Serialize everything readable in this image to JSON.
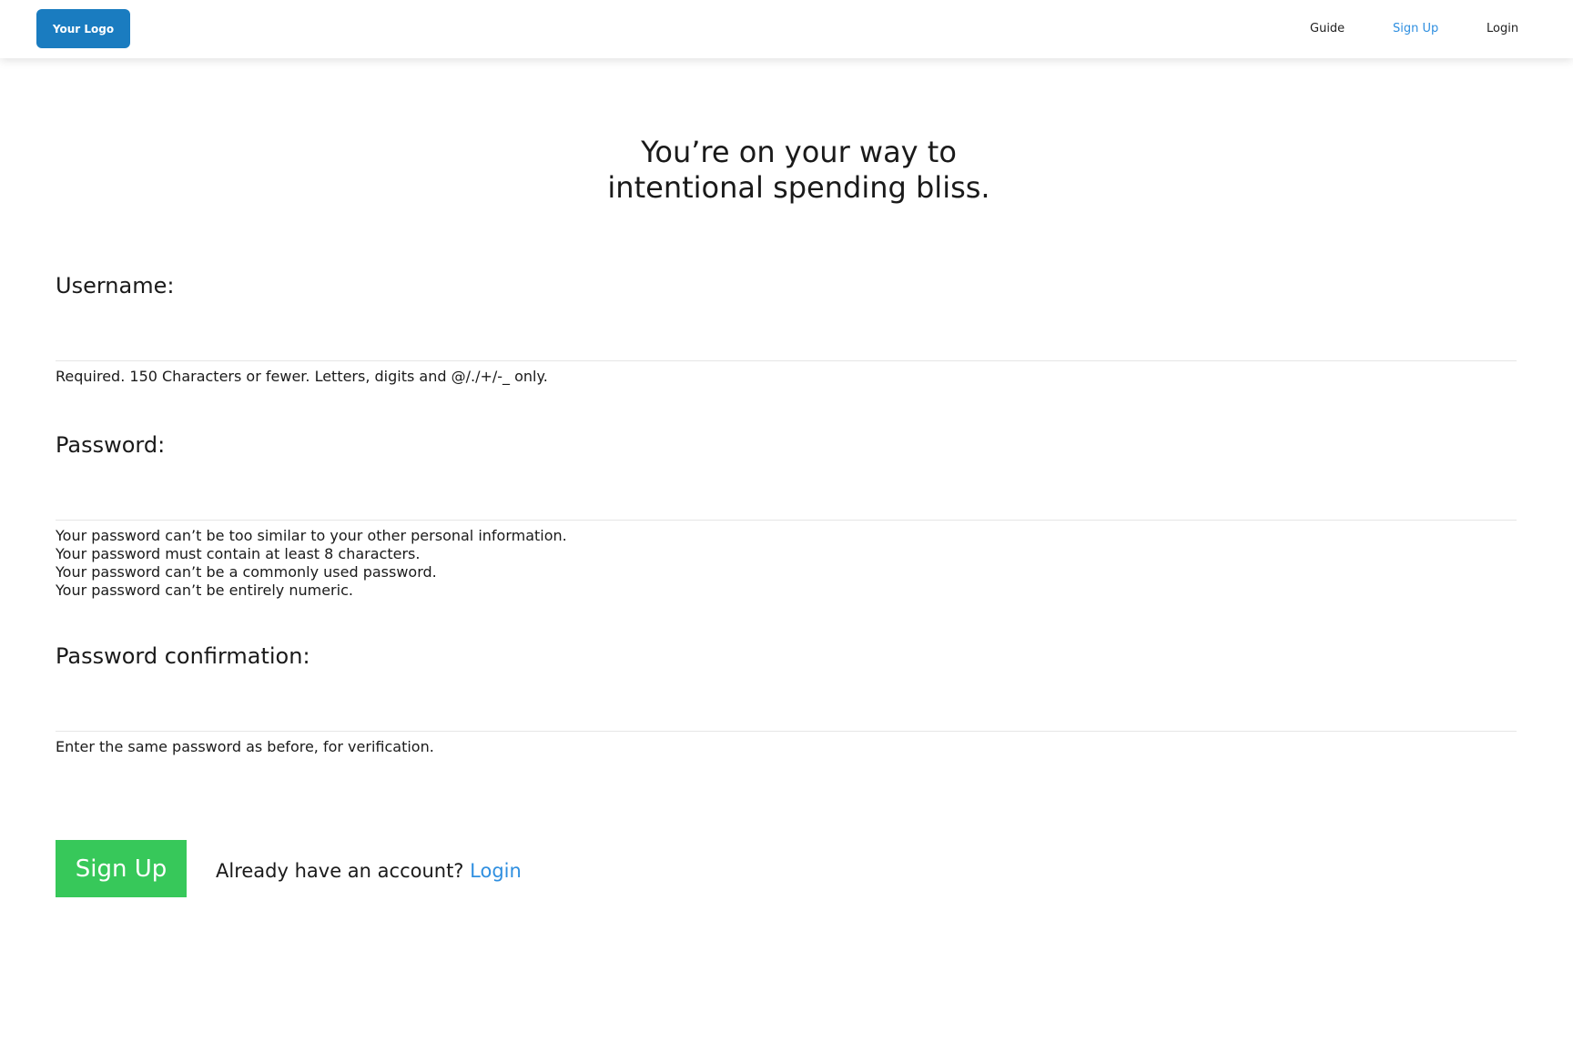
{
  "nav": {
    "logo": "Your Logo",
    "links": [
      {
        "label": "Guide"
      },
      {
        "label": "Sign Up"
      },
      {
        "label": "Login"
      }
    ]
  },
  "headline": {
    "line1": "You’re on your way to",
    "line2": "intentional spending bliss."
  },
  "form": {
    "username": {
      "label": "Username:",
      "value": "",
      "help": "Required. 150 Characters or fewer. Letters, digits and @/./+/-_ only."
    },
    "password": {
      "label": "Password:",
      "value": "",
      "help": [
        "Your password can’t be too similar to your other personal information.",
        "Your password must contain at least 8 characters.",
        "Your password can’t be a commonly used password.",
        "Your password can’t be entirely numeric."
      ]
    },
    "password_confirmation": {
      "label": "Password confirmation:",
      "value": "",
      "help": "Enter the same password as before, for verification."
    },
    "submit_label": "Sign Up",
    "already_text": "Already have an account?",
    "login_link": "Login"
  },
  "colors": {
    "logo_bg": "#1a7cc0",
    "link_blue": "#2f8fe0",
    "submit_green": "#37c85a"
  }
}
